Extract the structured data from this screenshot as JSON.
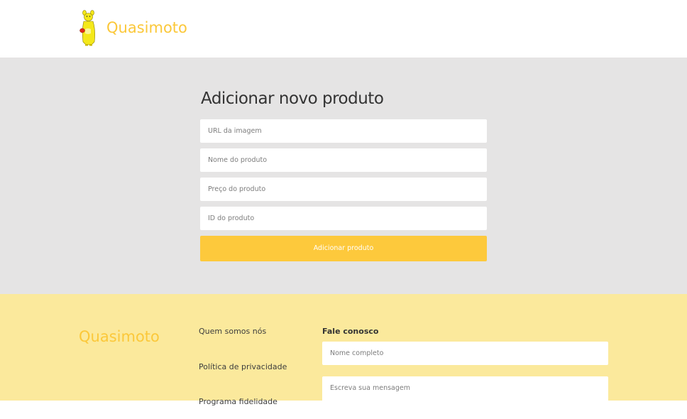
{
  "header": {
    "brand": "Quasimoto",
    "logo_icon": "yellow-figure-logo-icon"
  },
  "main": {
    "title": "Adicionar novo produto",
    "fields": [
      {
        "placeholder": "URL da imagem",
        "value": ""
      },
      {
        "placeholder": "Nome do produto",
        "value": ""
      },
      {
        "placeholder": "Preço do produto",
        "value": ""
      },
      {
        "placeholder": "ID do produto",
        "value": ""
      }
    ],
    "submit_label": "Adicionar produto"
  },
  "footer": {
    "brand": "Quasimoto",
    "links": [
      "Quem somos nós",
      "Política de privacidade",
      "Programa fidelidade"
    ],
    "contact": {
      "title": "Fale conosco",
      "name_placeholder": "Nome completo",
      "message_placeholder": "Escreva sua mensagem"
    }
  },
  "colors": {
    "accent": "#fdc93c",
    "brand_text": "#fbc83a",
    "main_bg": "#e5e4e4",
    "footer_bg": "#fbe99c"
  }
}
